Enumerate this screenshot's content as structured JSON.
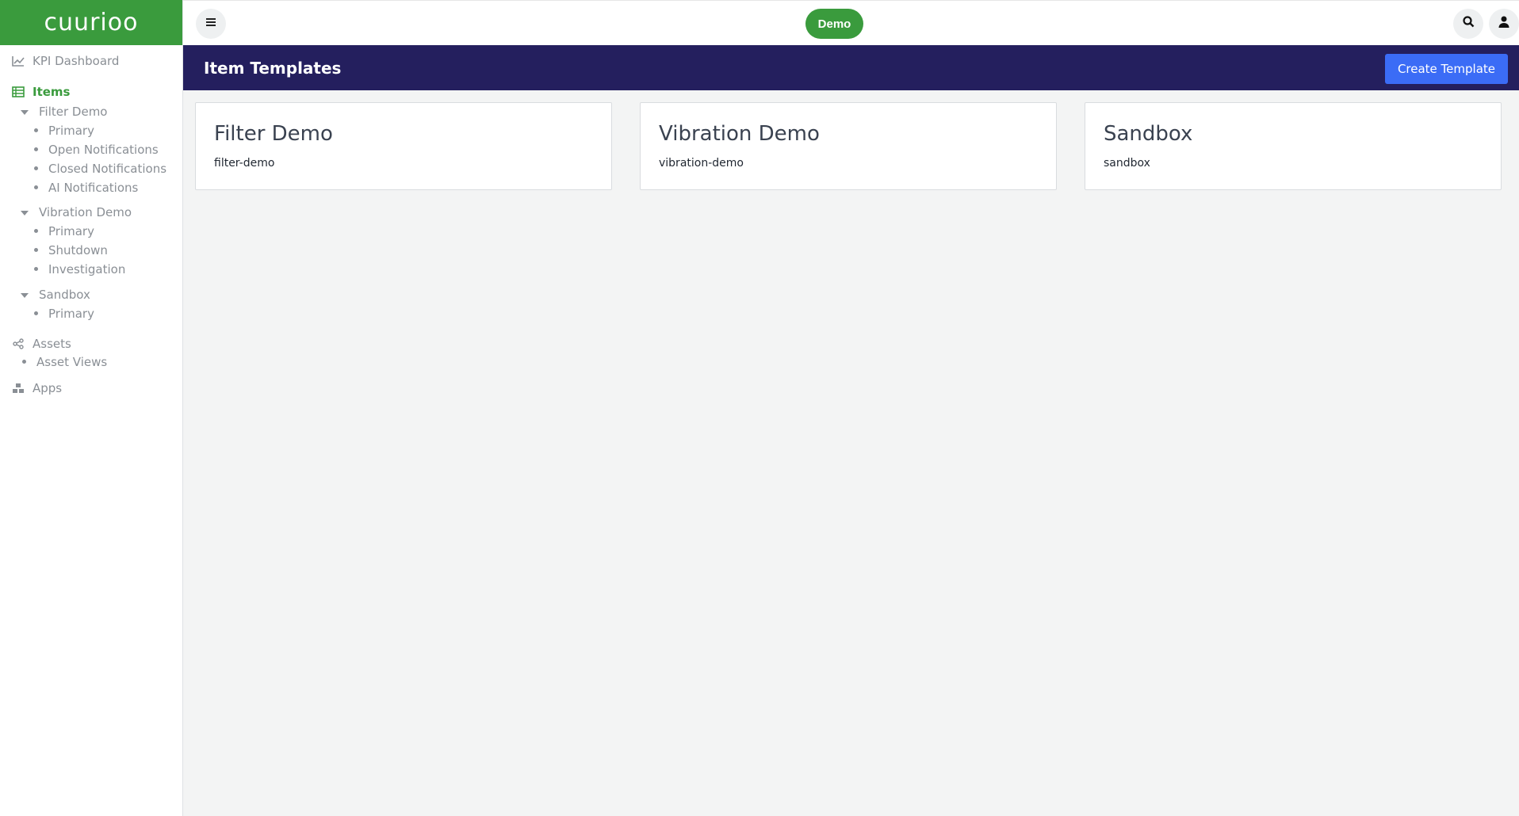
{
  "brand": {
    "logo_text": "cuurioo"
  },
  "sidebar": {
    "kpi_dashboard": "KPI Dashboard",
    "items": "Items",
    "groups": [
      {
        "label": "Filter Demo",
        "children": [
          "Primary",
          "Open Notifications",
          "Closed Notifications",
          "AI Notifications"
        ]
      },
      {
        "label": "Vibration Demo",
        "children": [
          "Primary",
          "Shutdown",
          "Investigation"
        ]
      },
      {
        "label": "Sandbox",
        "children": [
          "Primary"
        ]
      }
    ],
    "assets": "Assets",
    "asset_views": "Asset Views",
    "apps": "Apps"
  },
  "topbar": {
    "workspace": "Demo"
  },
  "header": {
    "title": "Item Templates",
    "create_button": "Create Template"
  },
  "templates": [
    {
      "title": "Filter Demo",
      "slug": "filter-demo"
    },
    {
      "title": "Vibration Demo",
      "slug": "vibration-demo"
    },
    {
      "title": "Sandbox",
      "slug": "sandbox"
    }
  ],
  "colors": {
    "brand_green": "#3a9b3d",
    "header_navy": "#241f5e",
    "button_blue": "#3b6cf6"
  },
  "icons": [
    "line-chart-icon",
    "table-icon",
    "share-nodes-icon",
    "cubes-icon",
    "hamburger-menu-icon",
    "search-icon",
    "user-icon"
  ]
}
